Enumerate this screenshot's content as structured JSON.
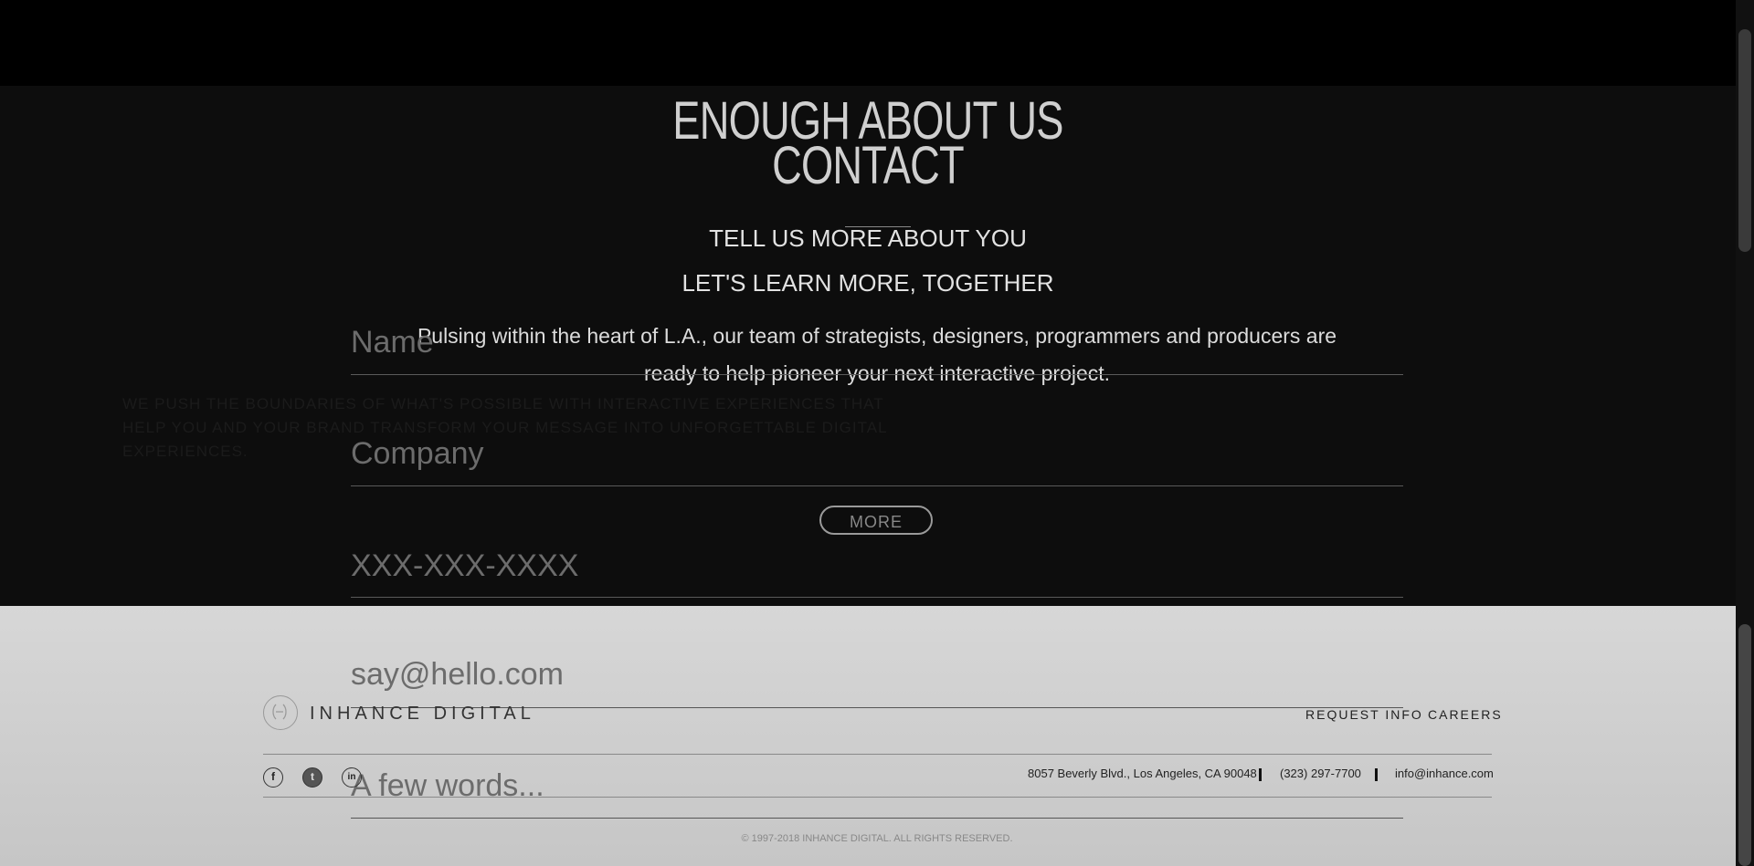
{
  "hero": {
    "title_line1": "ENOUGH ABOUT US",
    "title_line2": "CONTACT",
    "subtitle": "TELL US MORE ABOUT YOU",
    "tagline": "LET'S LEARN MORE, TOGETHER",
    "paragraph": "Pulsing within the heart of L.A., our team of strategists, designers, programmers and producers are ready to help pioneer your next interactive project.",
    "more_label": "MORE"
  },
  "background_text": {
    "line1": "WE PUSH THE BOUNDARIES OF WHAT'S POSSIBLE WITH INTERACTIVE EXPERIENCES THAT",
    "line2": "HELP YOU AND YOUR BRAND TRANSFORM YOUR MESSAGE INTO UNFORGETTABLE DIGITAL",
    "line3": "EXPERIENCES."
  },
  "form": {
    "name_placeholder": "Name",
    "company_placeholder": "Company",
    "phone_placeholder": "XXX-XXX-XXXX",
    "email_placeholder": "say@hello.com",
    "message_placeholder": "A few words..."
  },
  "footer": {
    "brand": "INHANCE DIGITAL",
    "nav": [
      "REQUEST INFO",
      "CAREERS"
    ],
    "social": [
      {
        "icon": "facebook-icon",
        "glyph": "f"
      },
      {
        "icon": "twitter-icon",
        "glyph": "t"
      },
      {
        "icon": "linkedin-icon",
        "glyph": "in"
      }
    ],
    "address": "8057 Beverly Blvd., Los Angeles, CA 90048",
    "phone": "(323) 297-7700",
    "email": "info@inhance.com",
    "copyright": "© 1997-2018 INHANCE DIGITAL. ALL RIGHTS RESERVED."
  },
  "colors": {
    "top_bar": "#000000",
    "main_bg": "#0d0d0d",
    "footer_bg": "#cfcfcf"
  }
}
